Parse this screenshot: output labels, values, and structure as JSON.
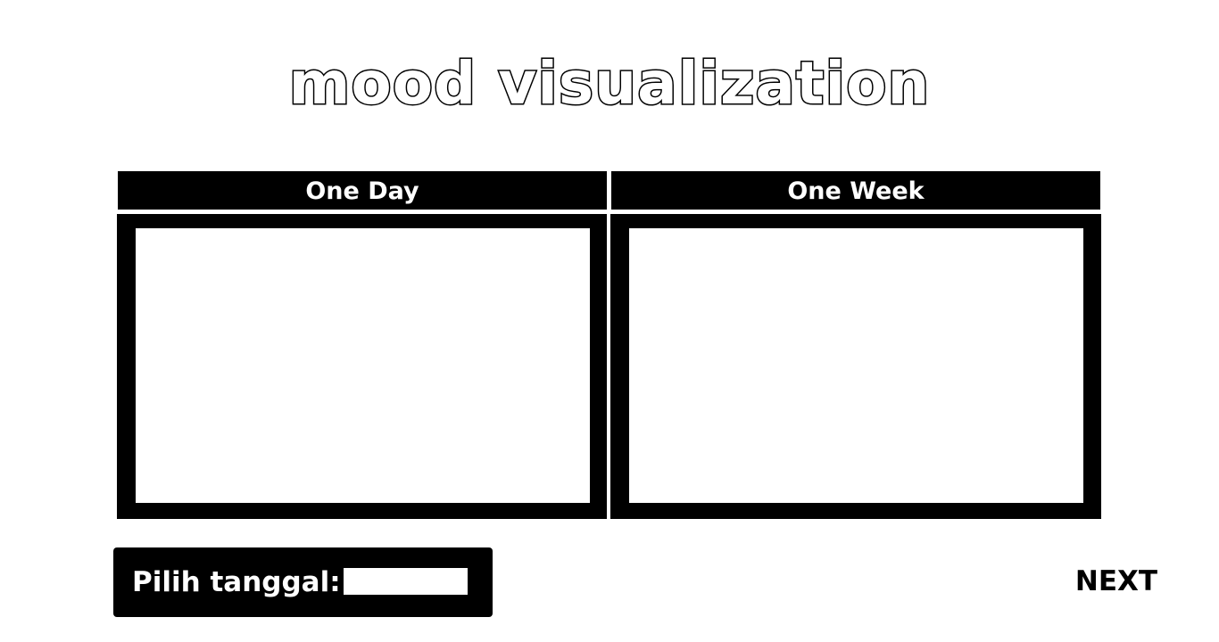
{
  "header": {
    "title": "mood visualization"
  },
  "tabs": [
    {
      "label": "One Day"
    },
    {
      "label": "One Week"
    }
  ],
  "date_picker": {
    "label": "Pilih tanggal:",
    "value": ""
  },
  "footer": {
    "next_label": "NEXT"
  },
  "colors": {
    "primary": "#000000",
    "background": "#ffffff"
  }
}
